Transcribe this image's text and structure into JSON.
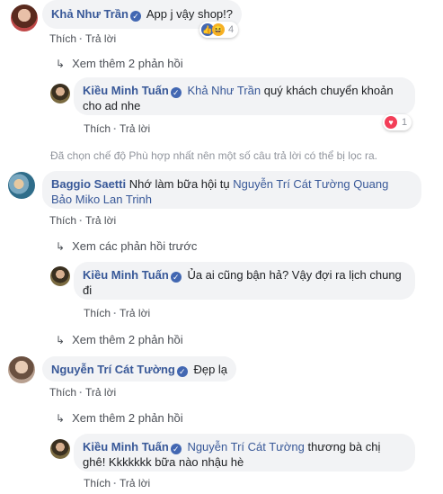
{
  "actions": {
    "like": "Thích",
    "reply": "Trả lời"
  },
  "c1": {
    "author": "Khả Như Trần",
    "text": "App j vậy shop!?",
    "reaction_count": "4",
    "view_more": "Xem thêm 2 phản hồi"
  },
  "r1": {
    "author": "Kiều Minh Tuấn",
    "mention": "Khả Như Trần",
    "text_line1": "quý khách chuyển khoản",
    "text_line2": "cho ad nhe",
    "reaction_count": "1"
  },
  "notice": "Đã chọn chế độ Phù hợp nhất nên một số câu trả lời có thể bị lọc ra.",
  "c2": {
    "author": "Baggio Saetti",
    "text": "Nhớ làm bữa hội tụ",
    "mention_line1": "Nguyễn Trí Cát Tường Quang",
    "mention_line2": "Bảo Miko Lan Trinh",
    "view_prev": "Xem các phản hồi trước"
  },
  "r2": {
    "author": "Kiều Minh Tuấn",
    "text_line1": "Ủa ai cũng bận hả? Vậy đợi ra lịch chung",
    "text_line2": "đi",
    "view_more": "Xem thêm 2 phản hồi"
  },
  "c3": {
    "author": "Nguyễn Trí Cát Tường",
    "text": "Đẹp lạ",
    "view_more": "Xem thêm 2 phản hồi"
  },
  "r3": {
    "author": "Kiều Minh Tuấn",
    "mention": "Nguyễn Trí Cát Tường",
    "text_line1": "thương bà chị",
    "text_line2": "ghê! Kkkkkkk bữa nào nhậu hè"
  },
  "icons": {
    "verified": "verified-badge-icon",
    "arrow": "reply-arrow-icon",
    "like": "like-reaction-icon",
    "haha": "haha-reaction-icon",
    "love": "love-reaction-icon"
  },
  "colors": {
    "link": "#385898",
    "bubble": "#f2f3f5",
    "muted": "#90949c",
    "like": "#4267b2",
    "love": "#f33e58",
    "haha": "#f7b125"
  }
}
